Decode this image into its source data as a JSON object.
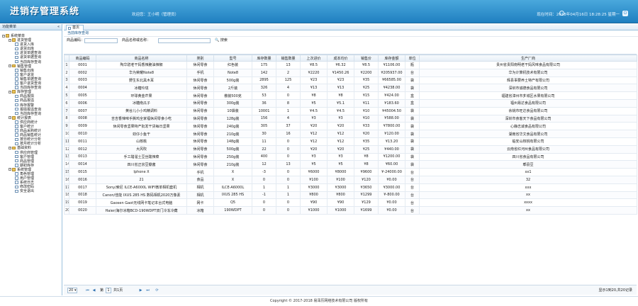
{
  "app": {
    "title": "进销存管理系统",
    "user": "欢迎您：王小明（管理员）",
    "time": "现在时间：2018年04月16日 18:28:25 星期一"
  },
  "sidebar": {
    "title": "功能菜单",
    "items": [
      {
        "level": 0,
        "label": "系统菜单",
        "type": "folder"
      },
      {
        "level": 1,
        "label": "进货管理",
        "type": "folder"
      },
      {
        "level": 2,
        "label": "进货入库",
        "type": "page"
      },
      {
        "level": 2,
        "label": "退货出库",
        "type": "page"
      },
      {
        "level": 2,
        "label": "进货单据查询",
        "type": "page"
      },
      {
        "level": 2,
        "label": "退货单据查询",
        "type": "page"
      },
      {
        "level": 2,
        "label": "当前库存查询",
        "type": "page"
      },
      {
        "level": 1,
        "label": "销售管理",
        "type": "folder"
      },
      {
        "level": 2,
        "label": "销售出库",
        "type": "page"
      },
      {
        "level": 2,
        "label": "客户退货",
        "type": "page"
      },
      {
        "level": 2,
        "label": "销售单据查询",
        "type": "page"
      },
      {
        "level": 2,
        "label": "客户退货查询",
        "type": "page"
      },
      {
        "level": 2,
        "label": "当前库存查询",
        "type": "page"
      },
      {
        "level": 1,
        "label": "库存管理",
        "type": "folder"
      },
      {
        "level": 2,
        "label": "商品报损",
        "type": "page"
      },
      {
        "level": 2,
        "label": "商品报溢",
        "type": "page"
      },
      {
        "level": 2,
        "label": "库存报警",
        "type": "page"
      },
      {
        "level": 2,
        "label": "报损报溢查询",
        "type": "page"
      },
      {
        "level": 2,
        "label": "当前库存查询",
        "type": "page"
      },
      {
        "level": 1,
        "label": "统计报表",
        "type": "folder"
      },
      {
        "level": 2,
        "label": "供应商统计",
        "type": "page"
      },
      {
        "level": 2,
        "label": "客户统计",
        "type": "page"
      },
      {
        "level": 2,
        "label": "商品采购统计",
        "type": "page"
      },
      {
        "level": 2,
        "label": "商品销售统计",
        "type": "page"
      },
      {
        "level": 2,
        "label": "按日统计分析",
        "type": "page"
      },
      {
        "level": 2,
        "label": "按月统计分析",
        "type": "page"
      },
      {
        "level": 1,
        "label": "基础资料",
        "type": "folder"
      },
      {
        "level": 2,
        "label": "供应商管理",
        "type": "page"
      },
      {
        "level": 2,
        "label": "客户管理",
        "type": "page"
      },
      {
        "level": 2,
        "label": "商品管理",
        "type": "page"
      },
      {
        "level": 2,
        "label": "期初库存",
        "type": "page"
      },
      {
        "level": 1,
        "label": "系统管理",
        "type": "folder"
      },
      {
        "level": 2,
        "label": "角色管理",
        "type": "page"
      },
      {
        "level": 2,
        "label": "用户管理",
        "type": "page"
      },
      {
        "level": 2,
        "label": "系统日志",
        "type": "page"
      },
      {
        "level": 2,
        "label": "修改密码",
        "type": "page"
      },
      {
        "level": 2,
        "label": "安全退出",
        "type": "page"
      }
    ]
  },
  "tabs": [
    {
      "label": "首页"
    }
  ],
  "breadcrumb": "当前库存查询",
  "search": {
    "code_label": "商品编码：",
    "name_label": "商品名称或名称：",
    "button": "搜索"
  },
  "table": {
    "columns": [
      "商品编码",
      "商品名称",
      "类别",
      "型号",
      "库存数量",
      "销售数量",
      "上次进价",
      "成本均价",
      "销售价",
      "库存金额",
      "单位",
      "生产厂商"
    ],
    "rows": [
      [
        "1",
        "0001",
        "陶华碧老干妈香辣脆油辣椒",
        "休闲零食",
        "红色装",
        "175",
        "13",
        "¥8.5",
        "¥6.32",
        "¥8.5",
        "¥1106.00",
        "瓶",
        "贵州省贵阳南明老干妈风味食品有限公司"
      ],
      [
        "2",
        "0002",
        "华为荣耀Note8",
        "手机",
        "Note8",
        "142",
        "2",
        "¥2220",
        "¥1450.26",
        "¥2200",
        "¥205937.00",
        "台",
        "华为计算机技术有限公司"
      ],
      [
        "3",
        "0003",
        "野生东北黑木耳",
        "休闲零食",
        "500g装",
        "2895",
        "125",
        "¥23",
        "¥23",
        "¥35",
        "¥66585.00",
        "袋",
        "辉县事要养土特产有限公司"
      ],
      [
        "4",
        "0004",
        "冰糖玲珑",
        "休闲零食",
        "2斤装",
        "326",
        "4",
        "¥13",
        "¥13",
        "¥25",
        "¥4238.00",
        "袋",
        "深圳市诚德食品有限公司"
      ],
      [
        "5",
        "0005",
        "环球黄金芒果",
        "休闲零食",
        "散装500克",
        "53",
        "0",
        "¥8",
        "¥8",
        "¥15",
        "¥424.00",
        "盒",
        "福建省漳州市芗城区水果有限公司"
      ],
      [
        "6",
        "0006",
        "冰糖南瓜子",
        "休闲零食",
        "300g装",
        "36",
        "8",
        "¥5",
        "¥5.1",
        "¥11",
        "¥183.60",
        "盒",
        "福州易达食品有限公司"
      ],
      [
        "7",
        "0007",
        "黄谷儿小小鸡精调料",
        "休闲零食",
        "10袋装",
        "10001",
        "1",
        "¥4.5",
        "¥4.5",
        "¥10",
        "¥45004.50",
        "袋",
        "余姚市旺达食品有限公司"
      ],
      [
        "8",
        "0008",
        "吉吉香辣味手撕鸡全家福休闲零食小吃",
        "休闲零食",
        "128g装",
        "156",
        "4",
        "¥3",
        "¥3",
        "¥10",
        "¥588.00",
        "袋",
        "深圳市食客天下食品有限公司"
      ],
      [
        "9",
        "0009",
        "休闲零食坚果特产批发干货每日坚果",
        "休闲零食",
        "240g装",
        "305",
        "37",
        "¥20",
        "¥20",
        "¥33",
        "¥7800.00",
        "袋",
        "心静志诚食品有限公司"
      ],
      [
        "10",
        "0010",
        "劲仔小鱼干",
        "休闲零食",
        "210g装",
        "30",
        "16",
        "¥12",
        "¥12",
        "¥20",
        "¥120.00",
        "袋",
        "湖南省华文食品有限公司"
      ],
      [
        "11",
        "0011",
        "山核桃",
        "休闲零食",
        "148g装",
        "11",
        "0",
        "¥12",
        "¥12",
        "¥35",
        "¥13.20",
        "袋",
        "临安山核桃有限公司"
      ],
      [
        "12",
        "0012",
        "大风吹",
        "休闲零食",
        "500g装",
        "22",
        "0",
        "¥20",
        "¥20",
        "¥25",
        "¥440.00",
        "袋",
        "云南省红河州食品有限公司"
      ],
      [
        "13",
        "0013",
        "手工醋溜土豆丝酸辣菜",
        "休闲零食",
        "250g装",
        "400",
        "0",
        "¥3",
        "¥3",
        "¥8",
        "¥1200.00",
        "袋",
        "四川省食品有限公司"
      ],
      [
        "14",
        "0014",
        "四川省正宗豆瓣酱",
        "休闲零食",
        "210g装",
        "12",
        "13",
        "¥5",
        "¥5",
        "¥8",
        "¥60.00",
        "袋",
        "郫县豆"
      ],
      [
        "15",
        "0015",
        "Iphone X",
        "手机",
        "X",
        "-3",
        "0",
        "¥6000",
        "¥8000",
        "¥9600",
        "¥-24000.00",
        "台",
        "xx1"
      ],
      [
        "16",
        "0016",
        "21",
        "食品",
        "X",
        "0",
        "0",
        "¥100",
        "¥100",
        "¥120",
        "¥0.00",
        "台",
        "32"
      ],
      [
        "17",
        "0017",
        "Sony/索尼 ILCE-A6000L WIFI微单相机套机",
        "相机",
        "ILCE-A6000L",
        "1",
        "1",
        "¥3000",
        "¥3000",
        "¥3650",
        "¥3000.00",
        "台",
        "xxx"
      ],
      [
        "18",
        "0018",
        "Canon/佳能 IXUS 285 HS 数码相机2020万像素",
        "相机",
        "IXUS 285 HS",
        "-1",
        "1",
        "¥800",
        "¥800",
        "¥1299",
        "¥-800.00",
        "台",
        "xx"
      ],
      [
        "19",
        "0019",
        "Gaosen Gaot无线网卡笔记本台式电脑",
        "网卡",
        "Q5",
        "0",
        "0",
        "¥90",
        "¥90",
        "¥129",
        "¥0.00",
        "台",
        "xxxx"
      ],
      [
        "20",
        "0020",
        "Haier/海尔冰箱BCD-190WDPT双门冷冻冷藏",
        "冰箱",
        "190WDPT",
        "0",
        "0",
        "¥1000",
        "¥1000",
        "¥1699",
        "¥0.00",
        "台",
        "xx"
      ]
    ]
  },
  "pager": {
    "page_size": "20",
    "page_label": "第",
    "page": "1",
    "total_pages": "共1页",
    "info": "显示1到20,共20记录"
  },
  "footer": "Copyright © 2017-2018 易泽历网络技术有限公司 版权所有"
}
